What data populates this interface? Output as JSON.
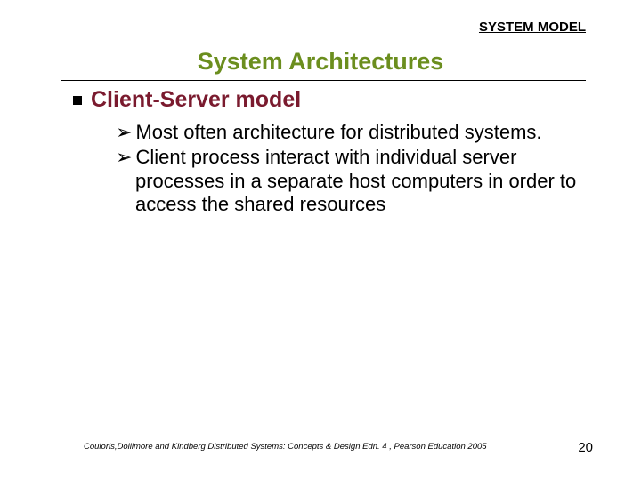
{
  "header": {
    "label": "SYSTEM MODEL"
  },
  "title": "System Architectures",
  "section": {
    "heading": "Client-Server model"
  },
  "subitems": [
    "Most often architecture for distributed systems.",
    "Client process interact with individual server processes in a separate host computers in order to access the shared resources"
  ],
  "footer": {
    "citation": "Couloris,Dollimore and Kindberg  Distributed Systems: Concepts & Design  Edn. 4 , Pearson Education 2005",
    "page": "20"
  }
}
